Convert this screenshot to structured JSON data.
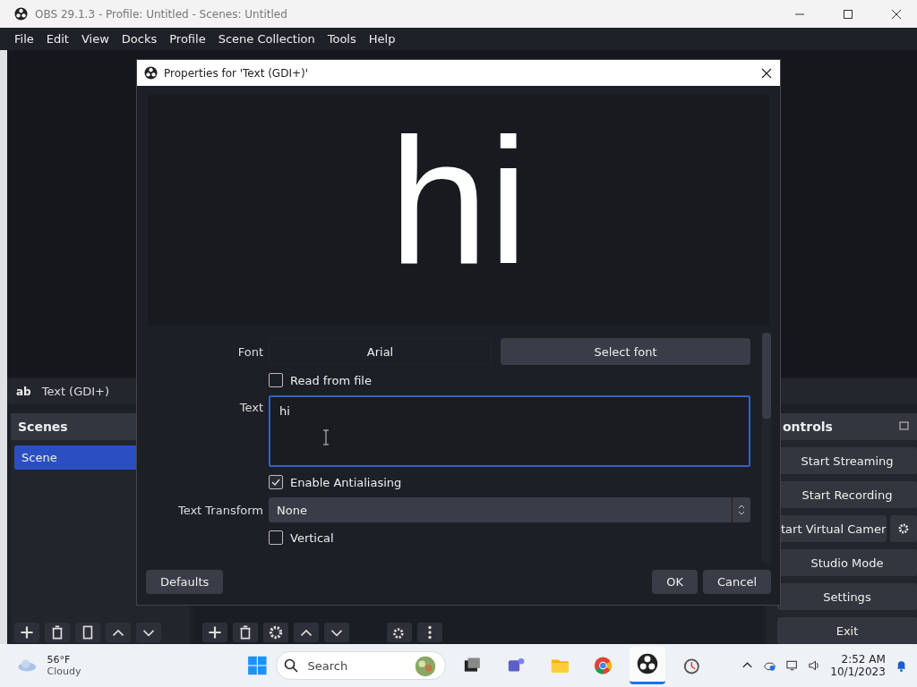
{
  "window": {
    "title": "OBS 29.1.3 - Profile: Untitled - Scenes: Untitled"
  },
  "menu": [
    "File",
    "Edit",
    "View",
    "Docks",
    "Profile",
    "Scene Collection",
    "Tools",
    "Help"
  ],
  "source_bar": {
    "icon_text": "ab",
    "label": "Text (GDI+)"
  },
  "scenes_dock": {
    "title": "Scenes",
    "items": [
      {
        "label": "Scene",
        "selected": true
      }
    ]
  },
  "controls_dock": {
    "title": "ontrols",
    "buttons": [
      {
        "label": "Start Streaming",
        "kind": "plain"
      },
      {
        "label": "Start Recording",
        "kind": "plain"
      },
      {
        "label": "tart Virtual Camer",
        "kind": "with-settings"
      },
      {
        "label": "Studio Mode",
        "kind": "plain"
      },
      {
        "label": "Settings",
        "kind": "plain"
      },
      {
        "label": "Exit",
        "kind": "plain"
      }
    ]
  },
  "dialog": {
    "title": "Properties for 'Text (GDI+)'",
    "preview_text": "hi",
    "properties": [
      {
        "kind": "font",
        "label": "Font",
        "value": "Arial",
        "button": "Select font"
      },
      {
        "kind": "checkbox",
        "label": "Read from file",
        "checked": false
      },
      {
        "kind": "textarea",
        "label": "Text",
        "value": "hi"
      },
      {
        "kind": "checkbox",
        "label": "Enable Antialiasing",
        "checked": true
      },
      {
        "kind": "select",
        "label": "Text Transform",
        "value": "None"
      },
      {
        "kind": "checkbox",
        "label": "Vertical",
        "checked": false
      }
    ],
    "buttons": {
      "left": "Defaults",
      "ok": "OK",
      "cancel": "Cancel"
    }
  },
  "taskbar": {
    "weather_temp": "56°F",
    "weather_text": "Cloudy",
    "search_placeholder": "Search",
    "time": "2:52 AM",
    "date": "10/1/2023"
  }
}
